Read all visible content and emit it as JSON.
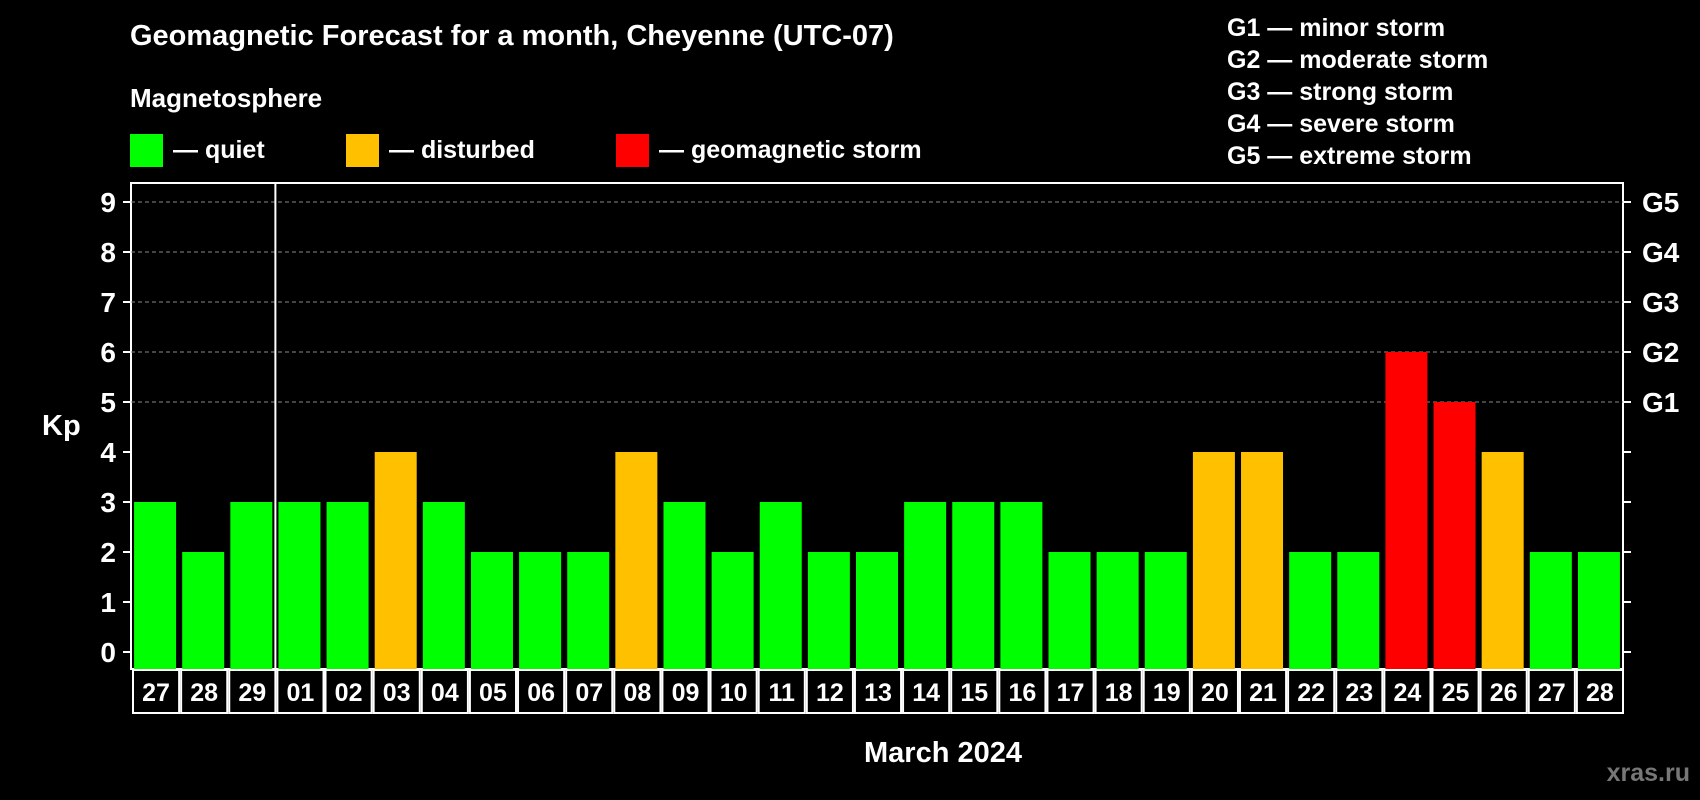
{
  "title": "Geomagnetic Forecast for a month, Cheyenne (UTC-07)",
  "subtitle": "Magnetosphere",
  "legend": [
    {
      "label": "— quiet",
      "color": "#00ff00"
    },
    {
      "label": "— disturbed",
      "color": "#ffc000"
    },
    {
      "label": "— geomagnetic storm",
      "color": "#ff0000"
    }
  ],
  "storm_scale": [
    "G1 — minor storm",
    "G2 — moderate storm",
    "G3 — strong storm",
    "G4 — severe storm",
    "G5 — extreme storm"
  ],
  "watermark": "xras.ru",
  "chart_data": {
    "type": "bar",
    "xlabel": "March 2024",
    "ylabel": "Kp",
    "ylim": [
      0,
      9
    ],
    "y_ticks": [
      0,
      1,
      2,
      3,
      4,
      5,
      6,
      7,
      8,
      9
    ],
    "right_ticks": [
      {
        "value": 5,
        "label": "G1"
      },
      {
        "value": 6,
        "label": "G2"
      },
      {
        "value": 7,
        "label": "G3"
      },
      {
        "value": 8,
        "label": "G4"
      },
      {
        "value": 9,
        "label": "G5"
      }
    ],
    "grid": "dashed at Kp 5-9",
    "month_separator_after_index": 2,
    "categories": [
      "27",
      "28",
      "29",
      "01",
      "02",
      "03",
      "04",
      "05",
      "06",
      "07",
      "08",
      "09",
      "10",
      "11",
      "12",
      "13",
      "14",
      "15",
      "16",
      "17",
      "18",
      "19",
      "20",
      "21",
      "22",
      "23",
      "24",
      "25",
      "26",
      "27",
      "28"
    ],
    "values": [
      3,
      2,
      3,
      3,
      3,
      4,
      3,
      2,
      2,
      2,
      4,
      3,
      2,
      3,
      2,
      2,
      3,
      3,
      3,
      2,
      2,
      2,
      4,
      4,
      2,
      2,
      6,
      5,
      4,
      2,
      2
    ],
    "colors": {
      "quiet": "#00ff00",
      "disturbed": "#ffc000",
      "storm": "#ff0000"
    }
  }
}
